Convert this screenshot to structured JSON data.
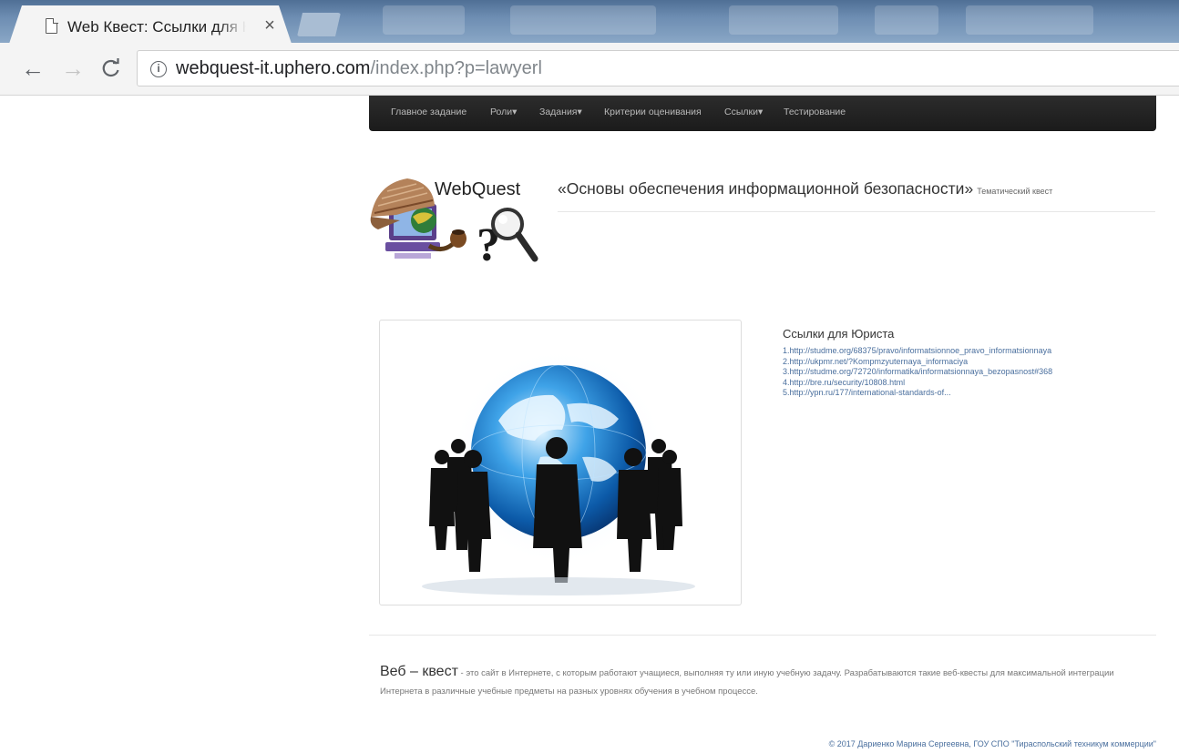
{
  "browser": {
    "tab": {
      "title": "Web Квест: Ссылки для Юриста",
      "close": "×"
    },
    "toolbar": {
      "back": "←",
      "forward": "→",
      "reload": "C"
    },
    "address": {
      "host": "webquest-it.uphero.com",
      "path": "/index.php?p=lawyerl",
      "info": "i"
    }
  },
  "nav": {
    "items": [
      {
        "label": "Главное задание"
      },
      {
        "label": "Роли▾"
      },
      {
        "label": "Задания▾"
      },
      {
        "label": "Критерии оценивания"
      },
      {
        "label": "Ссылки▾"
      },
      {
        "label": "Тестирование"
      }
    ]
  },
  "header": {
    "logo_text": "WebQuest",
    "title": "«Основы обеспечения информационной безопасности»",
    "subtitle": "Тематический квест"
  },
  "main": {
    "links_title": "Ссылки для Юриста",
    "links": [
      "1.http://studme.org/68375/pravo/informatsionnoe_pravo_informatsionnaya",
      "2.http://ukpmr.net/?Kompmzyuternaya_informaciya",
      "3.http://studme.org/72720/informatika/informatsionnaya_bezopasnost#368",
      "4.http://bre.ru/security/10808.html",
      "5.http://ypn.ru/177/international-standards-of..."
    ]
  },
  "definition": {
    "term": "Веб – квест",
    "text": " - это сайт в Интернете, с которым работают учащиеся, выполняя ту или иную учебную задачу. Разрабатываются такие веб-квесты для максимальной интеграции Интернета в различные учебные предметы на разных уровнях обучения в учебном процессе."
  },
  "footer": {
    "text": "© 2017 Дариенко Марина Сергеевна, ГОУ СПО \"Тираспольский техникум коммерции\""
  },
  "colors": {
    "nav_bg": "#1f1f1f",
    "link": "#4a6f9e",
    "text": "#333333"
  }
}
